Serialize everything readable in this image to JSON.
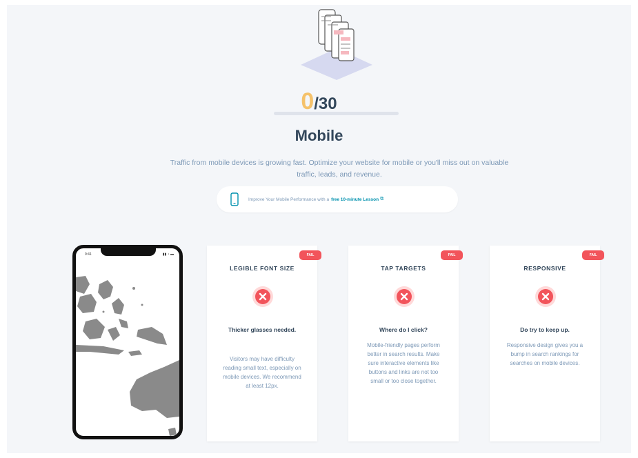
{
  "score": {
    "value": "0",
    "total": "/30",
    "progress": 0
  },
  "title": "Mobile",
  "description": "Traffic from mobile devices is growing fast. Optimize your website for mobile or you'll miss out on valuable traffic, leads, and revenue.",
  "lesson": {
    "icon": "mobile-phone-icon",
    "text": "Improve Your Mobile Performance with a",
    "link": "free 10-minute Lesson",
    "link_icon": "external-link-icon"
  },
  "device": {
    "status_time": "9:41",
    "status_icons": "▮▮ ◔ ▬",
    "screen": "map-of-southeast-asia-and-australia",
    "frame_color": "#111111"
  },
  "cards": [
    {
      "badge": "FAIL",
      "title": "LEGIBLE FONT SIZE",
      "headline": "Thicker glasses needed.",
      "body": "Visitors may have difficulty reading small text, especially on mobile devices. We recommend at least 12px."
    },
    {
      "badge": "FAIL",
      "title": "TAP TARGETS",
      "headline": "Where do I click?",
      "body": "Mobile-friendly pages perform better in search results. Make sure interactive elements like buttons and links are not too small or too close together."
    },
    {
      "badge": "FAIL",
      "title": "RESPONSIVE",
      "headline": "Do try to keep up.",
      "body": "Responsive design gives you a bump in search rankings for searches on mobile devices."
    }
  ],
  "colors": {
    "accent": "#f5c26b",
    "fail": "#f2545b",
    "text_dark": "#33475b",
    "text_muted": "#7c98b6",
    "link": "#0091ae",
    "panel_bg": "#f4f6f9"
  }
}
